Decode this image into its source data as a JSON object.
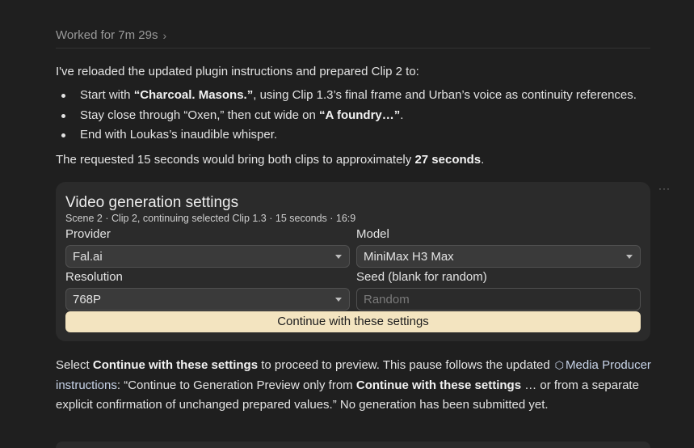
{
  "header": {
    "worked_label": "Worked for 7m 29s"
  },
  "message": {
    "intro": "I've reloaded the updated plugin instructions and prepared Clip 2 to:",
    "bullets": [
      {
        "pre": "Start with ",
        "bold": "“Charcoal. Masons.”",
        "post": ", using Clip 1.3’s final frame and Urban’s voice as continuity references."
      },
      {
        "pre": "Stay close through “Oxen,” then cut wide on ",
        "bold": "“A foundry…”",
        "post": "."
      },
      {
        "pre": "End with Loukas’s inaudible whisper.",
        "bold": "",
        "post": ""
      }
    ],
    "summary_pre": "The requested 15 seconds would bring both clips to approximately ",
    "summary_bold": "27 seconds",
    "summary_post": "."
  },
  "card": {
    "title": "Video generation settings",
    "subtitle": "Scene 2 · Clip 2, continuing selected Clip 1.3 · 15 seconds · 16:9",
    "provider_label": "Provider",
    "provider_value": "Fal.ai",
    "model_label": "Model",
    "model_value": "MiniMax H3 Max",
    "resolution_label": "Resolution",
    "resolution_value": "768P",
    "seed_label": "Seed (blank for random)",
    "seed_placeholder": "Random",
    "continue_label": "Continue with these settings",
    "more_label": "···"
  },
  "note": {
    "p1": "Select ",
    "b1": "Continue with these settings",
    "p2": " to proceed to preview. This pause follows the updated",
    "link_line1": "Media",
    "link_line2": "Producer instructions",
    "p3": ": “Continue to Generation Preview only from ",
    "b2": "Continue with these settings",
    "p4": " … or from a separate explicit confirmation of unchanged prepared values.” No generation has been submitted yet."
  },
  "colors": {
    "background": "#1f1f1f",
    "card": "#2b2b2b",
    "primary_button": "#f3e4c0",
    "link": "#c7d3e8"
  }
}
